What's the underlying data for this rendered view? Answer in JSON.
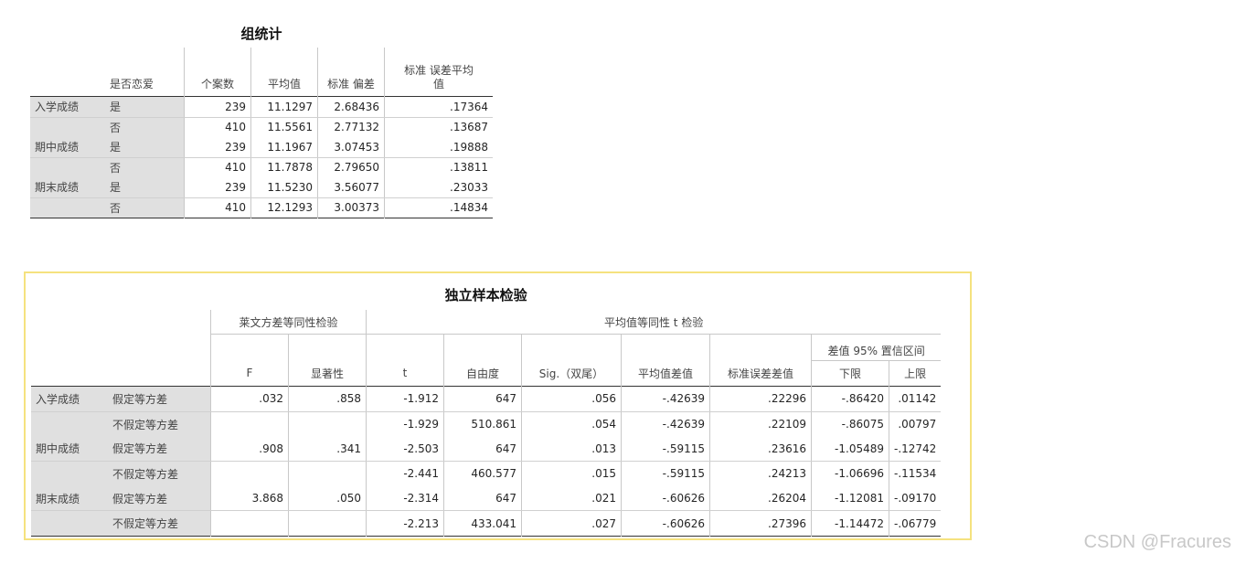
{
  "group_stats": {
    "title": "组统计",
    "headers": [
      "是否恋爱",
      "个案数",
      "平均值",
      "标准 偏差",
      "标准 误差平均\n值"
    ],
    "rows": [
      {
        "var": "入学成绩",
        "group": "是",
        "n": "239",
        "mean": "11.1297",
        "sd": "2.68436",
        "se": ".17364"
      },
      {
        "var": "",
        "group": "否",
        "n": "410",
        "mean": "11.5561",
        "sd": "2.77132",
        "se": ".13687"
      },
      {
        "var": "期中成绩",
        "group": "是",
        "n": "239",
        "mean": "11.1967",
        "sd": "3.07453",
        "se": ".19888"
      },
      {
        "var": "",
        "group": "否",
        "n": "410",
        "mean": "11.7878",
        "sd": "2.79650",
        "se": ".13811"
      },
      {
        "var": "期末成绩",
        "group": "是",
        "n": "239",
        "mean": "11.5230",
        "sd": "3.56077",
        "se": ".23033"
      },
      {
        "var": "",
        "group": "否",
        "n": "410",
        "mean": "12.1293",
        "sd": "3.00373",
        "se": ".14834"
      }
    ]
  },
  "indep_test": {
    "title": "独立样本检验",
    "levene_header": "莱文方差等同性检验",
    "ttest_header": "平均值等同性 t 检验",
    "ci_header": "差值 95% 置信区间",
    "col_headers": [
      "F",
      "显著性",
      "t",
      "自由度",
      "Sig.（双尾）",
      "平均值差值",
      "标准误差差值",
      "下限",
      "上限"
    ],
    "rows": [
      {
        "var": "入学成绩",
        "assump": "假定等方差",
        "F": ".032",
        "sig": ".858",
        "t": "-1.912",
        "df": "647",
        "sig2": ".056",
        "md": "-.42639",
        "sed": ".22296",
        "lo": "-.86420",
        "hi": ".01142"
      },
      {
        "var": "",
        "assump": "不假定等方差",
        "F": "",
        "sig": "",
        "t": "-1.929",
        "df": "510.861",
        "sig2": ".054",
        "md": "-.42639",
        "sed": ".22109",
        "lo": "-.86075",
        "hi": ".00797"
      },
      {
        "var": "期中成绩",
        "assump": "假定等方差",
        "F": ".908",
        "sig": ".341",
        "t": "-2.503",
        "df": "647",
        "sig2": ".013",
        "md": "-.59115",
        "sed": ".23616",
        "lo": "-1.05489",
        "hi": "-.12742"
      },
      {
        "var": "",
        "assump": "不假定等方差",
        "F": "",
        "sig": "",
        "t": "-2.441",
        "df": "460.577",
        "sig2": ".015",
        "md": "-.59115",
        "sed": ".24213",
        "lo": "-1.06696",
        "hi": "-.11534"
      },
      {
        "var": "期末成绩",
        "assump": "假定等方差",
        "F": "3.868",
        "sig": ".050",
        "t": "-2.314",
        "df": "647",
        "sig2": ".021",
        "md": "-.60626",
        "sed": ".26204",
        "lo": "-1.12081",
        "hi": "-.09170"
      },
      {
        "var": "",
        "assump": "不假定等方差",
        "F": "",
        "sig": "",
        "t": "-2.213",
        "df": "433.041",
        "sig2": ".027",
        "md": "-.60626",
        "sed": ".27396",
        "lo": "-1.14472",
        "hi": "-.06779"
      }
    ]
  },
  "watermark": "CSDN @Fracures"
}
